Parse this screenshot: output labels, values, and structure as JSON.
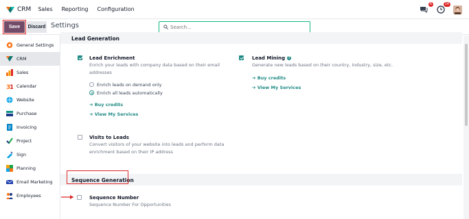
{
  "navbar": {
    "app_name": "CRM",
    "menus": [
      "Sales",
      "Reporting",
      "Configuration"
    ],
    "chat_badge": "6",
    "activity_badge": "14"
  },
  "control": {
    "save_label": "Save",
    "discard_label": "Discard",
    "title": "Settings",
    "search_placeholder": "Search..."
  },
  "sidebar": {
    "items": [
      {
        "label": "General Settings",
        "icon": "settings-icon",
        "color": "#f97316"
      },
      {
        "label": "CRM",
        "icon": "crm-icon",
        "color": "#0ea5a4"
      },
      {
        "label": "Sales",
        "icon": "sales-icon",
        "color": "#f59e0b"
      },
      {
        "label": "Calendar",
        "icon": "calendar-icon",
        "color": "#ef4444"
      },
      {
        "label": "Website",
        "icon": "website-icon",
        "color": "#0ea5e9"
      },
      {
        "label": "Purchase",
        "icon": "purchase-icon",
        "color": "#0d9488"
      },
      {
        "label": "Invoicing",
        "icon": "invoicing-icon",
        "color": "#0284c7"
      },
      {
        "label": "Project",
        "icon": "project-icon",
        "color": "#16a34a"
      },
      {
        "label": "Sign",
        "icon": "sign-icon",
        "color": "#0ea5e9"
      },
      {
        "label": "Planning",
        "icon": "planning-icon",
        "color": "#f59e0b"
      },
      {
        "label": "Email Marketing",
        "icon": "email-marketing-icon",
        "color": "#1e40af"
      },
      {
        "label": "Employees",
        "icon": "employees-icon",
        "color": "#f97316"
      }
    ]
  },
  "lead_generation": {
    "section_title": "Lead Generation",
    "enrichment": {
      "title": "Lead Enrichment",
      "description": "Enrich your leads with company data based on their email addresses",
      "radio_on_demand": "Enrich leads on demand only",
      "radio_auto": "Enrich all leads automatically",
      "buy_credits": "Buy credits",
      "view_services": "View My Services"
    },
    "mining": {
      "title": "Lead Mining",
      "description": "Generate new leads based on their country, industry, size, etc.",
      "buy_credits": "Buy credits",
      "view_services": "View My Services"
    },
    "visits": {
      "title": "Visits to Leads",
      "description": "Convert visitors of your website into leads and perform data enrichment based on their IP address"
    }
  },
  "sequence_generation": {
    "section_title": "Sequence Generation",
    "number": {
      "title": "Sequence Number",
      "description": "Sequence Number For Opportunities"
    }
  },
  "colors": {
    "primary": "#714b67",
    "accent": "#1f8a84",
    "highlight": "#dc2626"
  }
}
